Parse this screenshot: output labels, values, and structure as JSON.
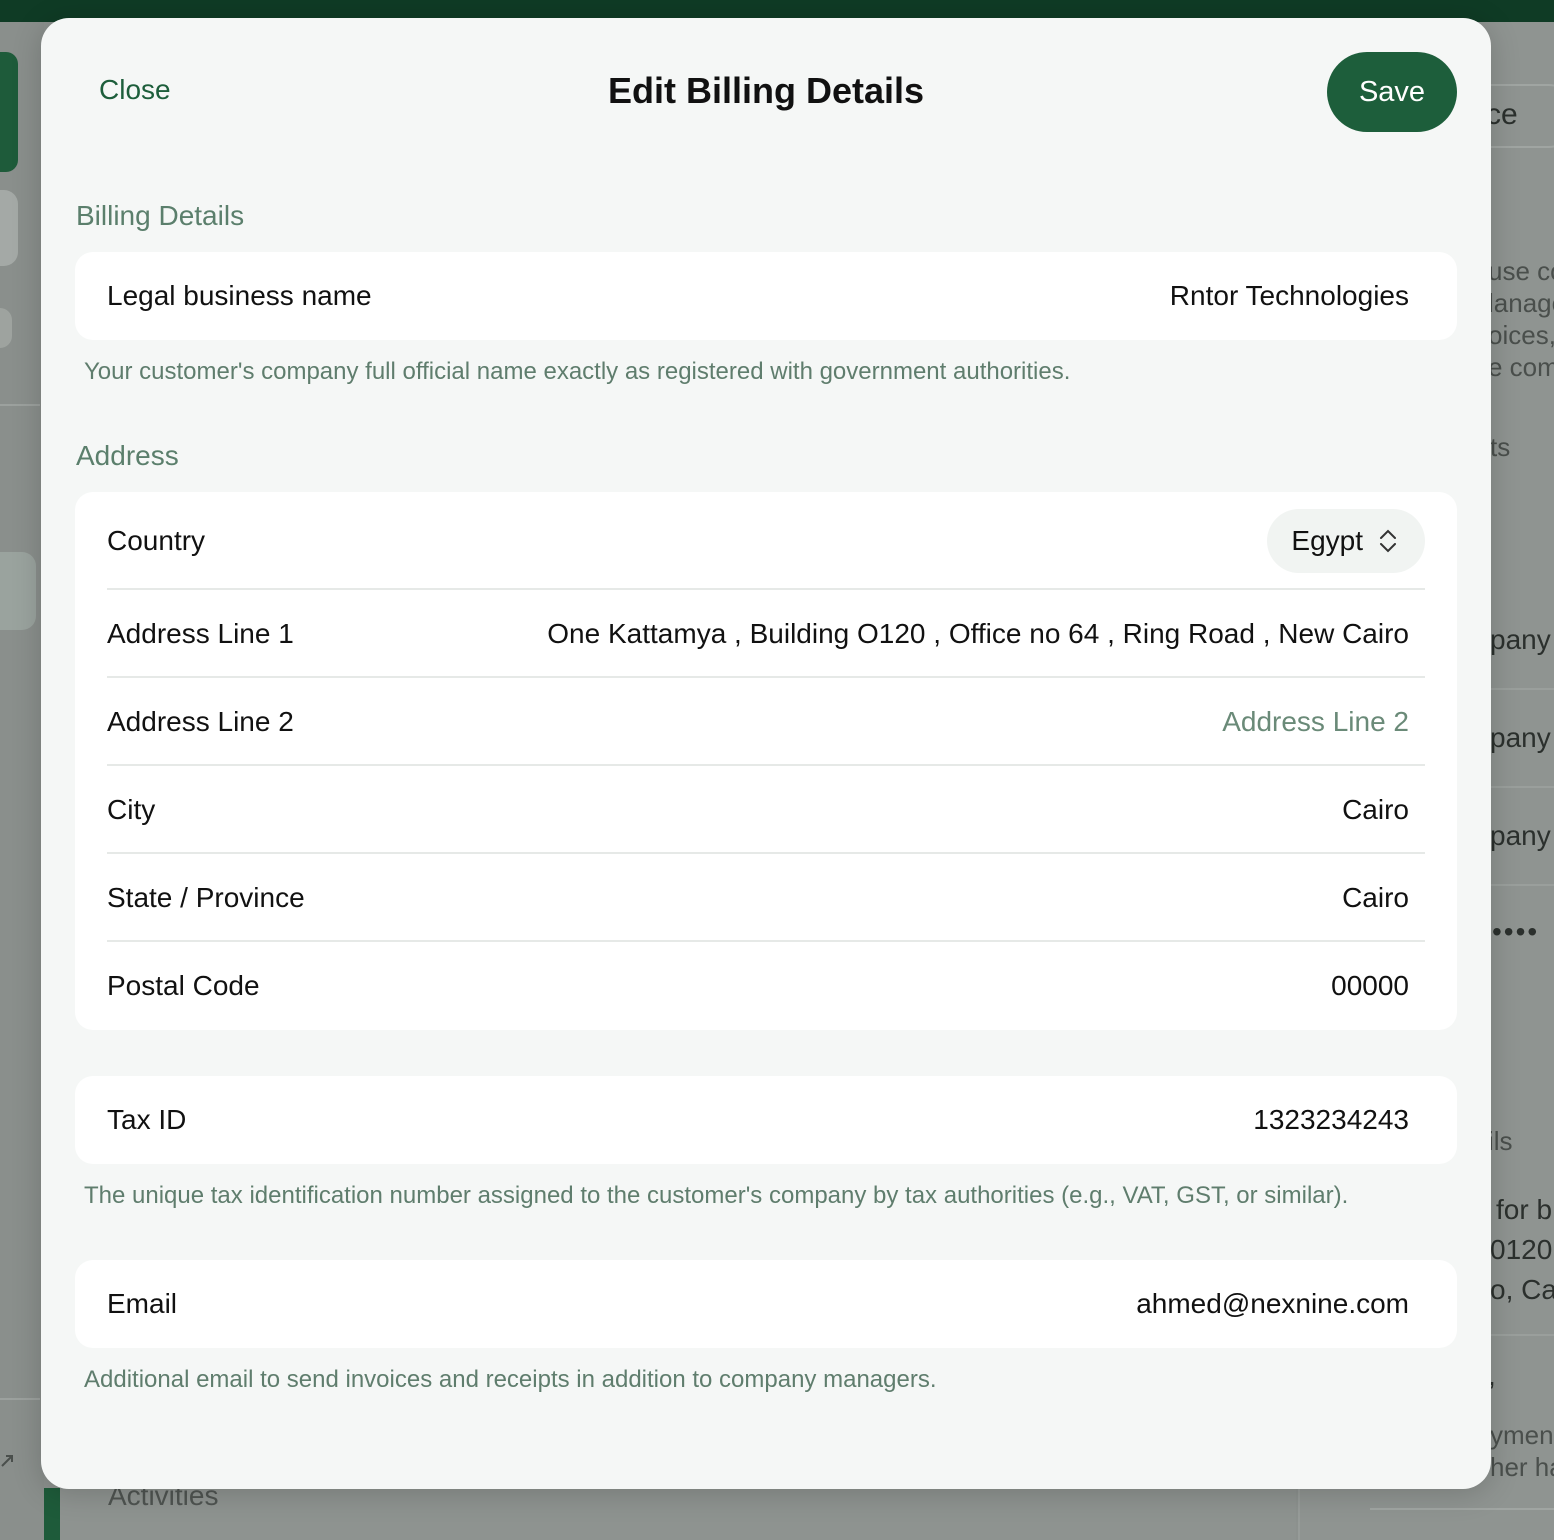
{
  "background": {
    "right_button_text": "ce",
    "right_lines": [
      "use co",
      "lanage",
      "oices,",
      "e com"
    ],
    "right_ts": "ts",
    "right_rows": [
      "pany",
      "pany",
      "pany"
    ],
    "right_dots": "••••",
    "right_ils": "ils",
    "right_address": [
      "for b",
      "0120",
      "o, Ca"
    ],
    "right_dash": ",",
    "right_bottom": [
      "yment",
      "her ha"
    ],
    "activities": "Activities"
  },
  "modal": {
    "close_label": "Close",
    "title": "Edit Billing Details",
    "save_label": "Save"
  },
  "billing": {
    "section_label": "Billing Details",
    "legal_name_label": "Legal business name",
    "legal_name_value": "Rntor Technologies",
    "legal_name_help": "Your customer's company full official name exactly as registered with government authorities."
  },
  "address": {
    "section_label": "Address",
    "country_label": "Country",
    "country_value": "Egypt",
    "line1_label": "Address Line 1",
    "line1_value": "One Kattamya , Building O120 , Office no 64 , Ring Road , New Cairo",
    "line2_label": "Address Line 2",
    "line2_placeholder": "Address Line 2",
    "city_label": "City",
    "city_value": "Cairo",
    "state_label": "State / Province",
    "state_value": "Cairo",
    "postal_label": "Postal Code",
    "postal_value": "00000"
  },
  "tax": {
    "label": "Tax ID",
    "value": "1323234243",
    "help": "The unique tax identification number assigned to the customer's company by tax authorities (e.g., VAT, GST, or similar)."
  },
  "email": {
    "label": "Email",
    "value": "ahmed@nexnine.com",
    "help": "Additional email to send invoices and receipts in addition to company managers."
  },
  "colors": {
    "brand_green": "#1d5e3b",
    "topbar_green": "#0f3b25",
    "muted_green_text": "#5b7f6c"
  }
}
